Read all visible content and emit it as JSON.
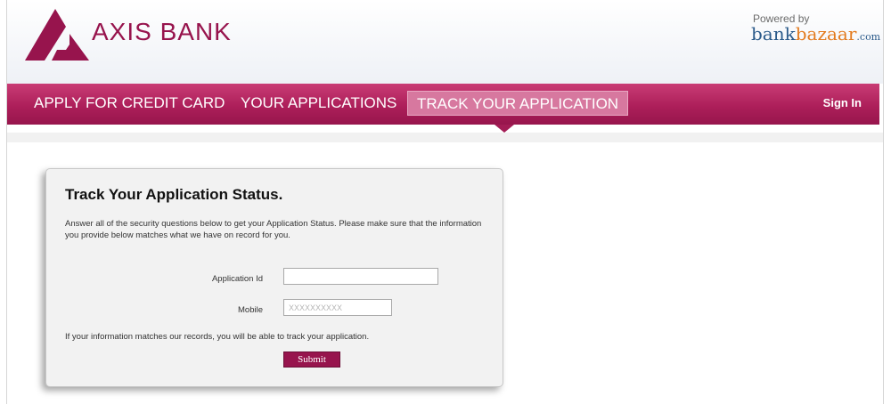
{
  "brand": {
    "name": "AXIS BANK",
    "primary_color": "#97144d",
    "logo_icon": "axis-bank-logo-icon"
  },
  "partner": {
    "powered_by": "Powered by",
    "logo_bank": "bank",
    "logo_bazaar": "bazaar",
    "logo_com": ".com"
  },
  "nav": {
    "items": [
      {
        "label": "APPLY FOR CREDIT CARD"
      },
      {
        "label": "YOUR APPLICATIONS"
      },
      {
        "label": "TRACK YOUR APPLICATION",
        "active": true
      }
    ],
    "signin": "Sign In"
  },
  "form": {
    "title": "Track Your Application Status.",
    "intro": "Answer all of the security questions below to get your Application Status. Please make sure that the information you provide below matches what we have on record for you.",
    "application_id_label": "Application Id",
    "application_id_value": "",
    "mobile_label": "Mobile",
    "mobile_placeholder": "XXXXXXXXXX",
    "note": "If your information matches our records, you will be able to track your application.",
    "submit_label": "Submit"
  }
}
